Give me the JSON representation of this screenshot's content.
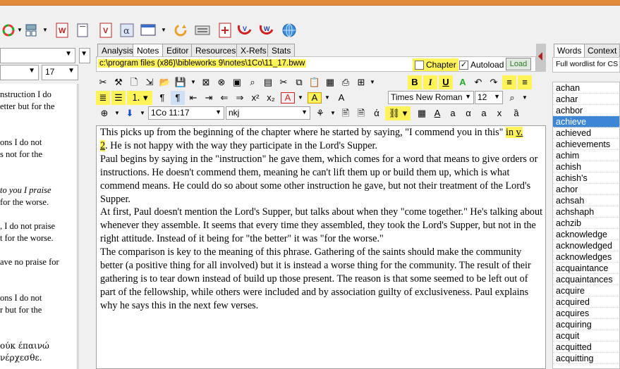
{
  "app": {
    "accent_highlight": "#fff35a",
    "selection_color": "#3d86d6"
  },
  "main_toolbar": {
    "icons": [
      "search-icon",
      "color-wheel-icon",
      "tree-icon",
      "word-doc-icon",
      "page-icon",
      "verse-doc-icon",
      "alpha-icon",
      "window-icon",
      "refresh-icon",
      "keyboard-icon",
      "add-note-icon",
      "verse-arrow-icon",
      "verse-word-arrow-icon",
      "globe-icon"
    ]
  },
  "left_panel": {
    "book_select": "",
    "version_select": "",
    "chapter_select": "17",
    "lines": [
      "nstruction I do",
      "etter but for the",
      "",
      "ons I do not",
      "s not for the",
      "",
      "to you I praise",
      "for the worse.",
      "",
      ", I do not praise",
      "t for the worse.",
      "",
      "ave no praise for",
      "",
      "ons I do not",
      "r but for the",
      "",
      "ούκ έπαινώ",
      "νέρχεσθε."
    ]
  },
  "tabs": [
    "Analysis",
    "Notes",
    "Editor",
    "Resources",
    "X-Refs",
    "Stats"
  ],
  "active_tab": "Notes",
  "notes_bar": {
    "path": "c:\\program files (x86)\\bibleworks 9\\notes\\1Co\\11_17.bww",
    "chapter_label": "Chapter",
    "chapter_checked": false,
    "autoload_label": "Autoload",
    "autoload_checked": true,
    "load_label": "Load"
  },
  "format_toolbar": {
    "font_name": "Times New Roman",
    "font_size": "12",
    "verse_ref": "1Co 11:17",
    "version": "nkj",
    "bold": "B",
    "italic": "I",
    "underline": "U"
  },
  "editor": {
    "paragraphs": [
      {
        "before": "This picks up from the beginning of the chapter where he started by saying, \"I commend you in this\" ",
        "ref_in": "in ",
        "ref": "v.",
        "ref2": "2",
        "after": ".  He is not happy with the way they participate in the Lord's Supper."
      },
      {
        "text": "Paul begins by saying in the \"instruction\" he gave them, which comes for a word that means to give orders or instructions. He doesn't commend them, meaning he can't lift them up or build them up, which is what commend means. He could do so about some other instruction he gave, but not their treatment of the Lord's Supper."
      },
      {
        "text": "At first, Paul doesn't mention the Lord's Supper, but talks about when they \"come together.\" He's talking about whenever they assemble. It seems that every time they assembled, they took the Lord's Supper, but not in the right attitude. Instead of it being for \"the better\" it was \"for the worse.\""
      },
      {
        "text": "The comparison is key to the meaning of this phrase. Gathering of the saints should make the community better (a positive thing for all involved) but it is instead a worse thing for the community. The result of their gathering is to tear down instead of build up those present. The reason is that some seemed to be left out of part of the fellowship, while others were included and by association guilty of exclusiveness. Paul explains why he says this in the next few verses."
      }
    ]
  },
  "right_panel": {
    "tabs": [
      "Words",
      "Context"
    ],
    "active_tab": "Words",
    "header": "Full wordlist for CS",
    "words": [
      "achan",
      "achar",
      "achbor",
      "achieve",
      "achieved",
      "achievements",
      "achim",
      "achish",
      "achish's",
      "achor",
      "achsah",
      "achshaph",
      "achzib",
      "acknowledge",
      "acknowledged",
      "acknowledges",
      "acquaintance",
      "acquaintances",
      "acquire",
      "acquired",
      "acquires",
      "acquiring",
      "acquit",
      "acquitted",
      "acquitting"
    ],
    "selected_word": "achieve"
  }
}
